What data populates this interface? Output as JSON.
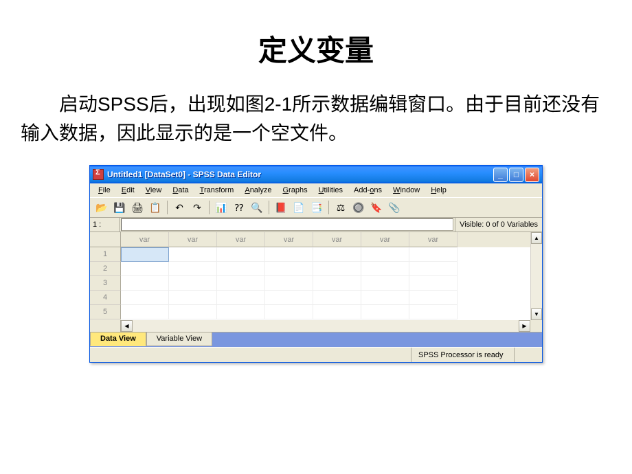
{
  "doc": {
    "title": "定义变量",
    "paragraph": "启动SPSS后，出现如图2-1所示数据编辑窗口。由于目前还没有输入数据，因此显示的是一个空文件。"
  },
  "window": {
    "title": "Untitled1 [DataSet0] - SPSS Data Editor",
    "buttons": {
      "min": "_",
      "max": "□",
      "close": "×"
    }
  },
  "menu": {
    "file": "File",
    "edit": "Edit",
    "view": "View",
    "data": "Data",
    "transform": "Transform",
    "analyze": "Analyze",
    "graphs": "Graphs",
    "utilities": "Utilities",
    "addons": "Add-ons",
    "window": "Window",
    "help": "Help"
  },
  "toolbar_icons": {
    "open": "📂",
    "save": "💾",
    "print": "🖨",
    "recall": "📋",
    "undo": "↶",
    "redo": "↷",
    "goto": "📊",
    "vars": "⁇",
    "find": "🔍",
    "insert_case": "📕",
    "insert_var": "📄",
    "split": "📑",
    "weight": "⚖",
    "select": "🔘",
    "value_labels": "🔖",
    "sets": "📎"
  },
  "info": {
    "cell_ref": "1 :",
    "visible": "Visible: 0 of 0 Variables"
  },
  "grid": {
    "col_label": "var",
    "rows": [
      "1",
      "2",
      "3",
      "4",
      "5"
    ],
    "cols": 7
  },
  "scroll": {
    "up": "▲",
    "down": "▼",
    "left": "◀",
    "right": "▶"
  },
  "tabs": {
    "data": "Data View",
    "variable": "Variable View"
  },
  "status": {
    "msg": "SPSS Processor is ready"
  }
}
